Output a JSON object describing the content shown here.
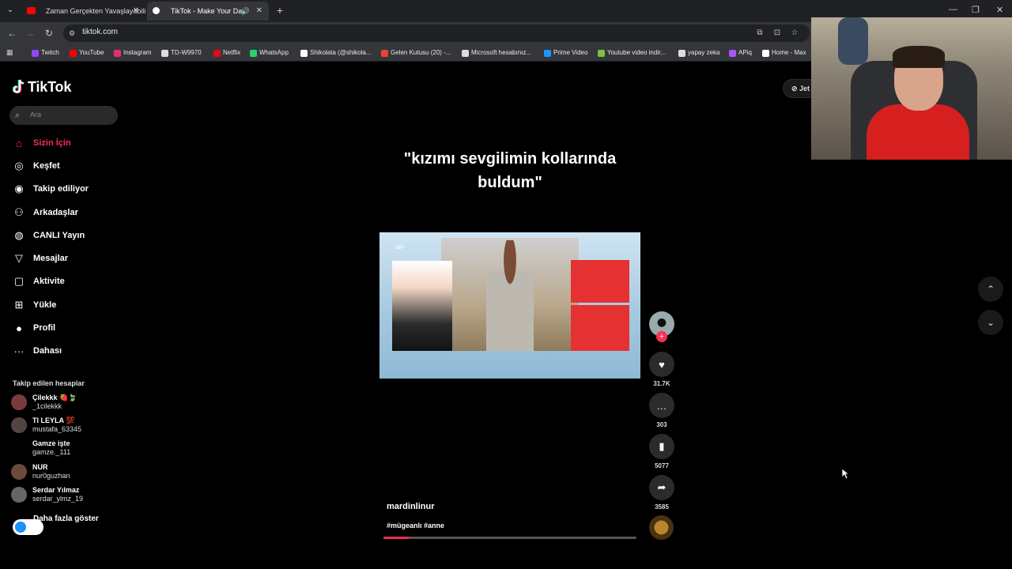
{
  "browser": {
    "tabs": [
      {
        "title": "Zaman Gerçekten Yavaşlayabilir",
        "active": false
      },
      {
        "title": "TikTok - Make Your Day",
        "active": true
      }
    ],
    "url": "tiktok.com",
    "bookmarks": [
      {
        "label": "Twitch",
        "color": "#9146ff"
      },
      {
        "label": "YouTube",
        "color": "#ff0000"
      },
      {
        "label": "Instagram",
        "color": "#e1306c"
      },
      {
        "label": "TD-W9970",
        "color": "#dddddd"
      },
      {
        "label": "Netflix",
        "color": "#e50914"
      },
      {
        "label": "WhatsApp",
        "color": "#25d366"
      },
      {
        "label": "Shikolata (@shikola...",
        "color": "#ffffff"
      },
      {
        "label": "Gelen Kutusu (20) -...",
        "color": "#ea4335"
      },
      {
        "label": "Microsoft hesabınız...",
        "color": "#dddddd"
      },
      {
        "label": "Prime Video",
        "color": "#1a98ff"
      },
      {
        "label": "Youtube video indir...",
        "color": "#7cc242"
      },
      {
        "label": "yapay zeka",
        "color": "#dddddd"
      },
      {
        "label": "APiq",
        "color": "#a855f7"
      },
      {
        "label": "Home - Max",
        "color": "#ffffff"
      }
    ]
  },
  "tiktok": {
    "logo": "TikTok",
    "search_placeholder": "Ara",
    "nav": [
      {
        "label": "Sizin İçin",
        "icon": "home-icon",
        "active": true
      },
      {
        "label": "Keşfet",
        "icon": "compass-icon",
        "active": false
      },
      {
        "label": "Takip ediliyor",
        "icon": "following-icon",
        "active": false
      },
      {
        "label": "Arkadaşlar",
        "icon": "friends-icon",
        "active": false
      },
      {
        "label": "CANLI Yayın",
        "icon": "live-icon",
        "active": false
      },
      {
        "label": "Mesajlar",
        "icon": "messages-icon",
        "active": false
      },
      {
        "label": "Aktivite",
        "icon": "activity-icon",
        "active": false
      },
      {
        "label": "Yükle",
        "icon": "upload-icon",
        "active": false
      },
      {
        "label": "Profil",
        "icon": "profile-icon",
        "active": false
      },
      {
        "label": "Dahası",
        "icon": "more-icon",
        "active": false
      }
    ],
    "following_title": "Takip edilen hesaplar",
    "following": [
      {
        "name": "Çilekkk 🍓🍃",
        "user": "_1cilekkk",
        "color": "#7a3b3b"
      },
      {
        "name": "Tl LEYLA 💯",
        "user": "mustafa_63345",
        "color": "#554444"
      },
      {
        "name": "Gamze işte",
        "user": "gamze._111",
        "color": "#000000"
      },
      {
        "name": "NUR",
        "user": "nur0guzhan",
        "color": "#6b4a3c"
      },
      {
        "name": "Serdar Yılmaz",
        "user": "serdar_ylmz_19",
        "color": "#666666"
      }
    ],
    "show_more": "Daha fazla göster",
    "get_app": "Jet"
  },
  "video": {
    "caption": "\"kızımı sevgilimin kollarında buldum\"",
    "channel_logo": "atv",
    "author": "mardinlinur",
    "hashtags": "#mügeanlı #anne",
    "progress": 0.1
  },
  "actions": {
    "likes": "31.7K",
    "comments": "303",
    "saves": "5077",
    "shares": "3585"
  },
  "colors": {
    "accent": "#fe2c55"
  }
}
